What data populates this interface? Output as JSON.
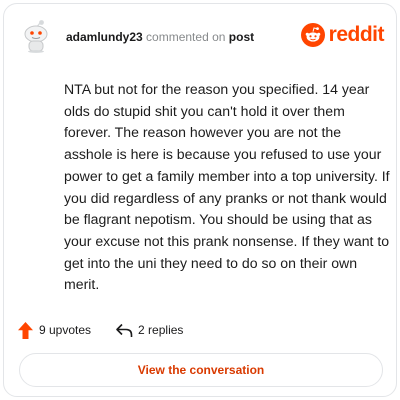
{
  "header": {
    "author": "adamlundy23",
    "action_text": "commented on",
    "post_link": "post",
    "brand_name": "reddit",
    "avatar_icon": "snoo-avatar-icon",
    "brand_icon": "reddit-alien-icon"
  },
  "comment": {
    "body": "NTA but not for the reason you specified. 14 year olds do stupid shit you can't hold it over them forever. The reason however you are not the asshole is here is because you refused to use your power to get a family member into a top university. If you did regardless of any pranks or not thank would be flagrant nepotism. You should be using that as your excuse not this prank nonsense. If they want to get into the uni they need to do so on their own merit."
  },
  "stats": {
    "upvotes": "9 upvotes",
    "replies": "2 replies",
    "upvote_icon": "upvote-arrow-icon",
    "reply_icon": "reply-arrow-icon"
  },
  "cta": {
    "label": "View the conversation"
  },
  "colors": {
    "brand": "#ff4500",
    "cta_text": "#d93a00",
    "border": "#e3e5e8",
    "muted_text": "#878a8c"
  }
}
